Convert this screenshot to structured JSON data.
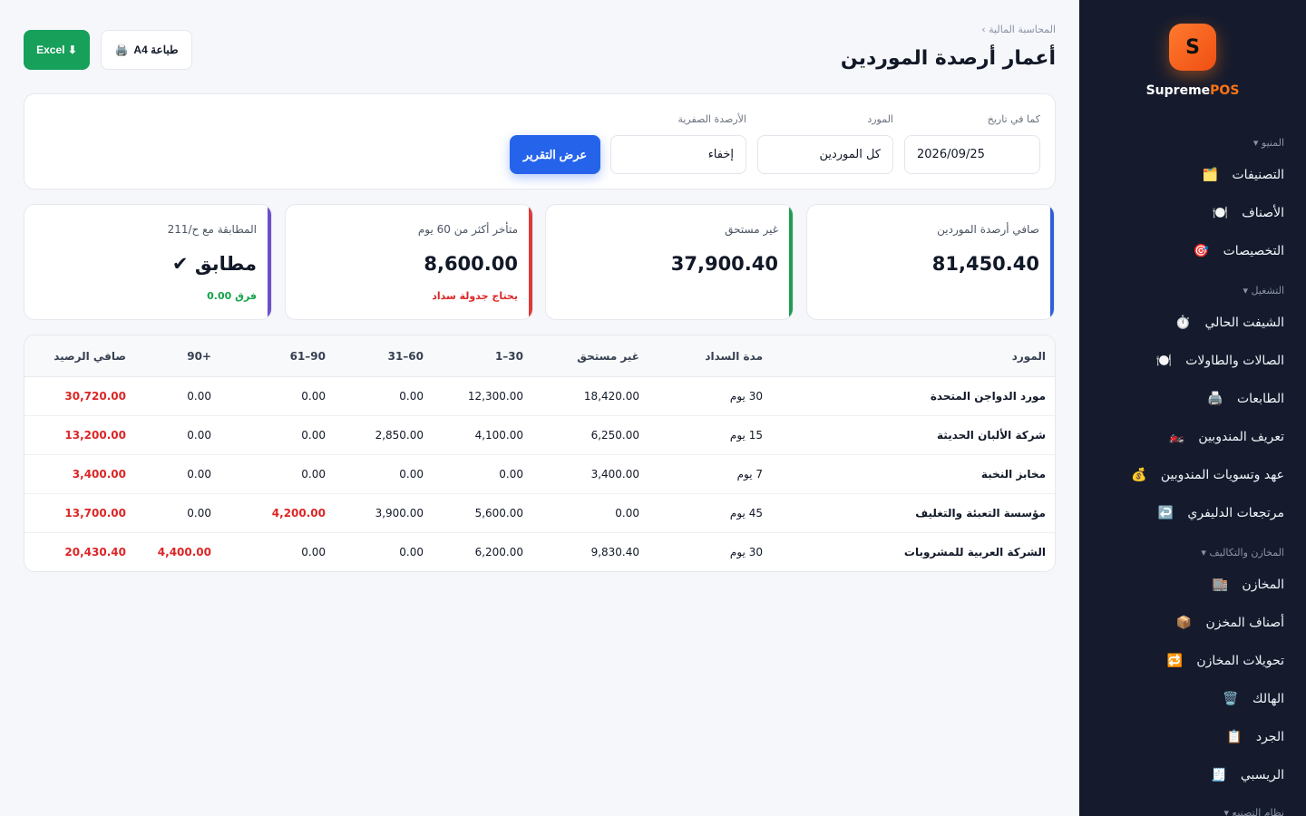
{
  "sidebar": {
    "logo_letter": "S",
    "brand_main": "Supreme",
    "brand_accent": "POS",
    "sections": [
      {
        "label": "المنيو ▾"
      },
      {
        "label": "التشغيل ▾"
      },
      {
        "label": "المخازن والتكاليف ▾"
      },
      {
        "label": "نظام التصنيع ▾"
      }
    ],
    "items": [
      {
        "label": "التصنيفات",
        "icon": "🗂️"
      },
      {
        "label": "الأصناف",
        "icon": "🍽️"
      },
      {
        "label": "التخصيصات",
        "icon": "🎯"
      },
      {
        "label": "الشيفت الحالي",
        "icon": "⏱️"
      },
      {
        "label": "الصالات والطاولات",
        "icon": "🍽️"
      },
      {
        "label": "الطابعات",
        "icon": "🖨️"
      },
      {
        "label": "تعريف المندوبين",
        "icon": "🏍️"
      },
      {
        "label": "عهد وتسويات المندوبين",
        "icon": "💰"
      },
      {
        "label": "مرتجعات الدليفري",
        "icon": "↩️"
      },
      {
        "label": "المخازن",
        "icon": "🏬"
      },
      {
        "label": "أصناف المخزن",
        "icon": "📦"
      },
      {
        "label": "تحويلات المخازن",
        "icon": "🔁"
      },
      {
        "label": "الهالك",
        "icon": "🗑️"
      },
      {
        "label": "الجرد",
        "icon": "📋"
      },
      {
        "label": "الريسبي",
        "icon": "🧾"
      }
    ]
  },
  "header": {
    "breadcrumb": "المحاسبة المالية ›",
    "title": "أعمار أرصدة الموردين",
    "excel_label": "Excel ⬇",
    "print_label": "طباعة A4",
    "print_icon": "🖨️"
  },
  "filters": {
    "date_label": "كما في تاريخ",
    "date_value": "2026/09/25",
    "supplier_label": "المورد",
    "supplier_value": "كل الموردين",
    "zero_label": "الأرصدة الصفرية",
    "zero_value": "إخفاء",
    "submit_label": "عرض التقرير"
  },
  "kpis": [
    {
      "label": "صافي أرصدة الموردين",
      "value": "81,450.40",
      "note": "",
      "color": "#2f5fd6"
    },
    {
      "label": "غير مستحق",
      "value": "37,900.40",
      "note": "",
      "color": "#1f9d55"
    },
    {
      "label": "متأخر أكثر من 60 يوم",
      "value": "8,600.00",
      "note": "يحتاج جدولة سداد",
      "color": "#dc3b3b"
    },
    {
      "label": "المطابقة مع ح/211",
      "value": "مطابق ✔",
      "note": "فرق 0.00",
      "color": "#6d4ec9"
    }
  ],
  "table": {
    "headers": {
      "supplier": "المورد",
      "terms": "مدة السداد",
      "not_due": "غير مستحق",
      "b1": "1–30",
      "b2": "31–60",
      "b3": "61–90",
      "b4": "90+",
      "net": "صافي الرصيد"
    },
    "rows": [
      {
        "supplier": "مورد الدواجن المتحدة",
        "terms": "30 يوم",
        "not_due": "18,420.00",
        "b1": "12,300.00",
        "b2": "0.00",
        "b3": "0.00",
        "b4": "0.00",
        "net": "30,720.00"
      },
      {
        "supplier": "شركة الألبان الحديثة",
        "terms": "15 يوم",
        "not_due": "6,250.00",
        "b1": "4,100.00",
        "b2": "2,850.00",
        "b3": "0.00",
        "b4": "0.00",
        "net": "13,200.00"
      },
      {
        "supplier": "مخابز النخبة",
        "terms": "7 يوم",
        "not_due": "3,400.00",
        "b1": "0.00",
        "b2": "0.00",
        "b3": "0.00",
        "b4": "0.00",
        "net": "3,400.00"
      },
      {
        "supplier": "مؤسسة التعبئة والتغليف",
        "terms": "45 يوم",
        "not_due": "0.00",
        "b1": "5,600.00",
        "b2": "3,900.00",
        "b3": "4,200.00",
        "b4": "0.00",
        "net": "13,700.00"
      },
      {
        "supplier": "الشركة العربية للمشروبات",
        "terms": "30 يوم",
        "not_due": "9,830.40",
        "b1": "6,200.00",
        "b2": "0.00",
        "b3": "0.00",
        "b4": "4,400.00",
        "net": "20,430.40"
      }
    ]
  }
}
